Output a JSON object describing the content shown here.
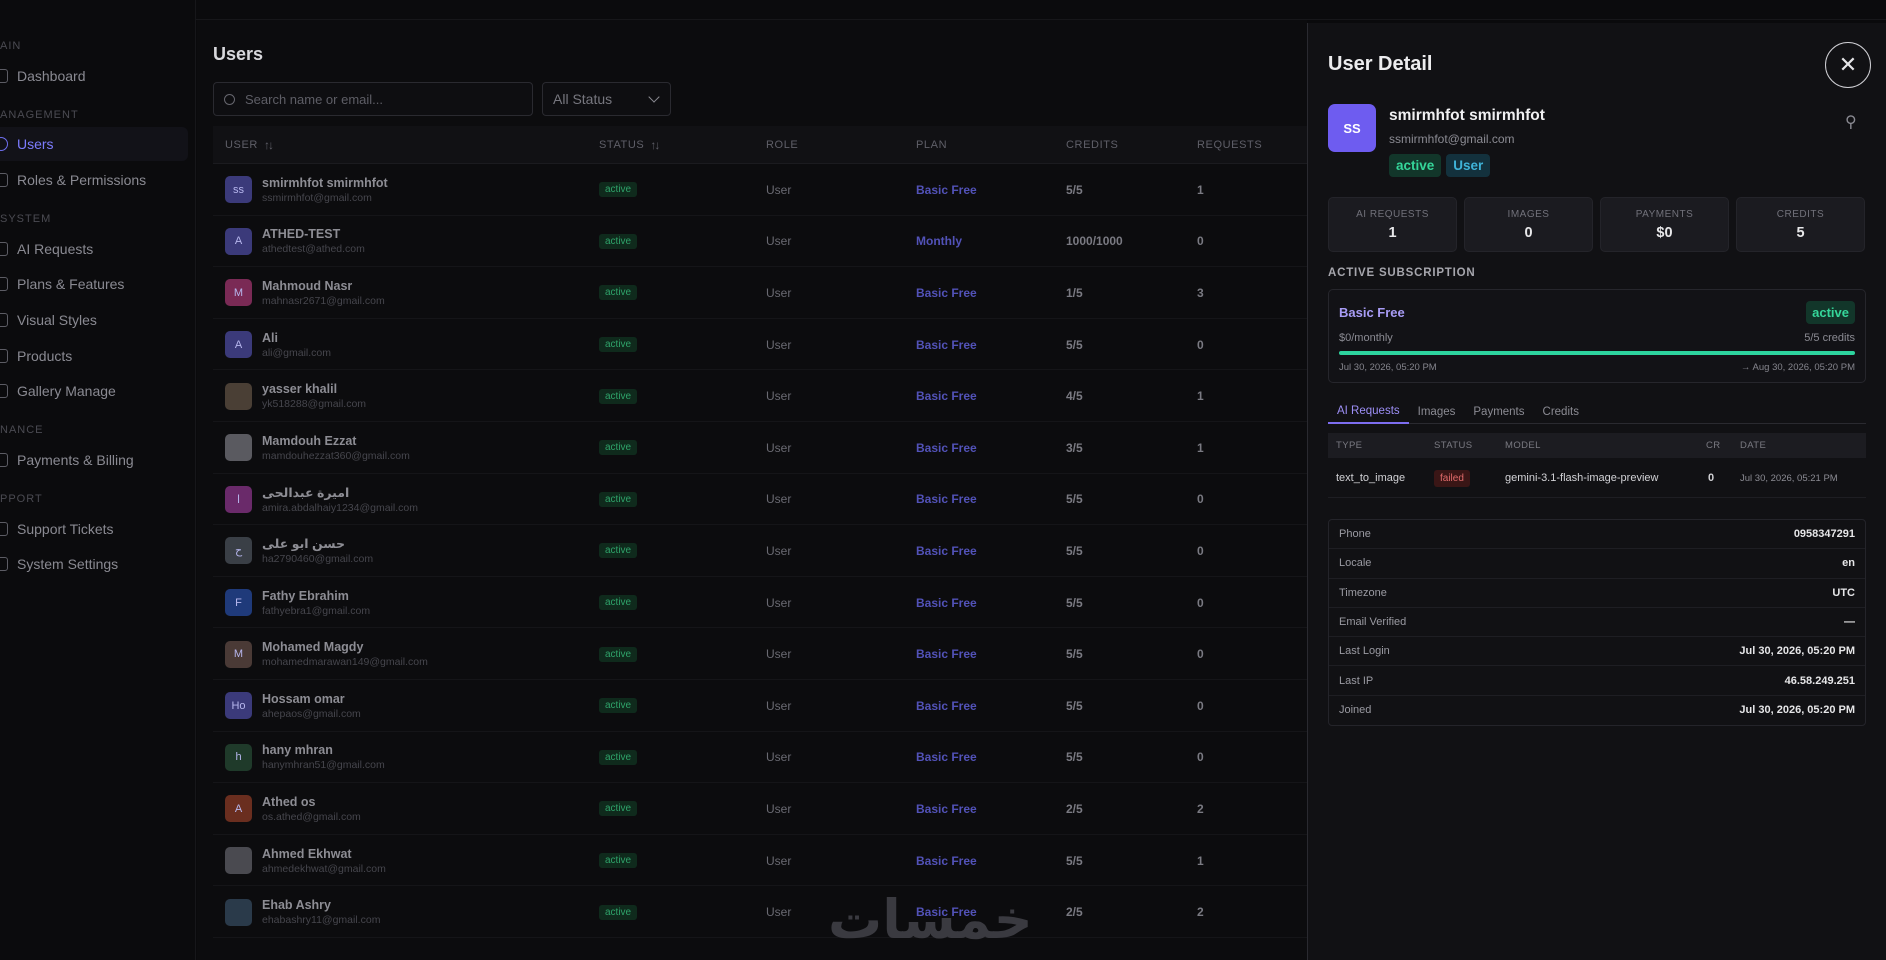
{
  "sidebar": {
    "sections": [
      "AIN",
      "ANAGEMENT",
      "SYSTEM",
      "NANCE",
      "PPORT"
    ],
    "items": [
      {
        "label": "Dashboard"
      },
      {
        "label": "Users"
      },
      {
        "label": "Roles & Permissions"
      },
      {
        "label": "AI Requests"
      },
      {
        "label": "Plans & Features"
      },
      {
        "label": "Visual Styles"
      },
      {
        "label": "Products"
      },
      {
        "label": "Gallery Manage"
      },
      {
        "label": "Payments & Billing"
      },
      {
        "label": "Support Tickets"
      },
      {
        "label": "System Settings"
      }
    ]
  },
  "main": {
    "title": "Users",
    "search_placeholder": "Search name or email...",
    "status_filter": "All Status",
    "columns": [
      "USER",
      "STATUS",
      "ROLE",
      "PLAN",
      "CREDITS",
      "REQUESTS"
    ],
    "rows": [
      {
        "initials": "ss",
        "avatar_color": "#3b3a7a",
        "name": "smirmhfot smirmhfot",
        "email": "ssmirmhfot@gmail.com",
        "status": "active",
        "role": "User",
        "plan": "Basic Free",
        "credits": "5/5",
        "requests": "1"
      },
      {
        "initials": "A",
        "avatar_color": "#3b3a7a",
        "name": "ATHED-TEST",
        "email": "athedtest@athed.com",
        "status": "active",
        "role": "User",
        "plan": "Monthly",
        "credits": "1000/1000",
        "requests": "0"
      },
      {
        "initials": "M",
        "avatar_color": "#7a2a55",
        "name": "Mahmoud Nasr",
        "email": "mahnasr2671@gmail.com",
        "status": "active",
        "role": "User",
        "plan": "Basic Free",
        "credits": "1/5",
        "requests": "3"
      },
      {
        "initials": "A",
        "avatar_color": "#3b3a7a",
        "name": "Ali",
        "email": "ali@gmail.com",
        "status": "active",
        "role": "User",
        "plan": "Basic Free",
        "credits": "5/5",
        "requests": "0"
      },
      {
        "initials": "",
        "avatar_color": "#4a3f35",
        "name": "yasser khalil",
        "email": "yk518288@gmail.com",
        "status": "active",
        "role": "User",
        "plan": "Basic Free",
        "credits": "4/5",
        "requests": "1"
      },
      {
        "initials": "",
        "avatar_color": "#5a5a60",
        "name": "Mamdouh Ezzat",
        "email": "mamdouhezzat360@gmail.com",
        "status": "active",
        "role": "User",
        "plan": "Basic Free",
        "credits": "3/5",
        "requests": "1"
      },
      {
        "initials": "ا",
        "avatar_color": "#6a2a6a",
        "name": "اميرة عبدالحى",
        "email": "amira.abdalhaiy1234@gmail.com",
        "status": "active",
        "role": "User",
        "plan": "Basic Free",
        "credits": "5/5",
        "requests": "0"
      },
      {
        "initials": "ح",
        "avatar_color": "#3a3f46",
        "name": "حسن ابو على",
        "email": "ha2790460@gmail.com",
        "status": "active",
        "role": "User",
        "plan": "Basic Free",
        "credits": "5/5",
        "requests": "0"
      },
      {
        "initials": "F",
        "avatar_color": "#1f3a7a",
        "name": "Fathy Ebrahim",
        "email": "fathyebra1@gmail.com",
        "status": "active",
        "role": "User",
        "plan": "Basic Free",
        "credits": "5/5",
        "requests": "0"
      },
      {
        "initials": "M",
        "avatar_color": "#4a3a36",
        "name": "Mohamed Magdy",
        "email": "mohamedmarawan149@gmail.com",
        "status": "active",
        "role": "User",
        "plan": "Basic Free",
        "credits": "5/5",
        "requests": "0"
      },
      {
        "initials": "Ho",
        "avatar_color": "#3b3a7a",
        "name": "Hossam omar",
        "email": "ahepaos@gmail.com",
        "status": "active",
        "role": "User",
        "plan": "Basic Free",
        "credits": "5/5",
        "requests": "0"
      },
      {
        "initials": "h",
        "avatar_color": "#1f3a2a",
        "name": "hany mhran",
        "email": "hanymhran51@gmail.com",
        "status": "active",
        "role": "User",
        "plan": "Basic Free",
        "credits": "5/5",
        "requests": "0"
      },
      {
        "initials": "A",
        "avatar_color": "#6a2e1f",
        "name": "Athed os",
        "email": "os.athed@gmail.com",
        "status": "active",
        "role": "User",
        "plan": "Basic Free",
        "credits": "2/5",
        "requests": "2"
      },
      {
        "initials": "",
        "avatar_color": "#4a4a50",
        "name": "Ahmed Ekhwat",
        "email": "ahmedekhwat@gmail.com",
        "status": "active",
        "role": "User",
        "plan": "Basic Free",
        "credits": "5/5",
        "requests": "1"
      },
      {
        "initials": "",
        "avatar_color": "#2a3a4a",
        "name": "Ehab Ashry",
        "email": "ehabashry11@gmail.com",
        "status": "active",
        "role": "User",
        "plan": "Basic Free",
        "credits": "2/5",
        "requests": "2"
      }
    ]
  },
  "watermark": "خمسات",
  "drawer": {
    "title": "User Detail",
    "close_glyph": "✕",
    "key_glyph": "⚲",
    "user": {
      "initials": "SS",
      "name": "smirmhfot smirmhfot",
      "email": "ssmirmhfot@gmail.com",
      "status": "active",
      "role": "User"
    },
    "stats": [
      {
        "label": "AI REQUESTS",
        "value": "1"
      },
      {
        "label": "IMAGES",
        "value": "0"
      },
      {
        "label": "PAYMENTS",
        "value": "$0"
      },
      {
        "label": "CREDITS",
        "value": "5"
      }
    ],
    "subscription": {
      "section_title": "ACTIVE SUBSCRIPTION",
      "plan": "Basic Free",
      "status": "active",
      "price": "$0/monthly",
      "credits": "5/5 credits",
      "credits_fraction": 1.0,
      "start": "Jul 30, 2026, 05:20 PM",
      "end": "→ Aug 30, 2026, 05:20 PM"
    },
    "tabs": [
      "AI Requests",
      "Images",
      "Payments",
      "Credits"
    ],
    "requests": {
      "columns": [
        "TYPE",
        "STATUS",
        "MODEL",
        "CR",
        "DATE"
      ],
      "rows": [
        {
          "type": "text_to_image",
          "status": "failed",
          "model": "gemini-3.1-flash-image-preview",
          "cr": "0",
          "date": "Jul 30, 2026, 05:21 PM"
        }
      ]
    },
    "info": [
      {
        "key": "Phone",
        "value": "0958347291"
      },
      {
        "key": "Locale",
        "value": "en"
      },
      {
        "key": "Timezone",
        "value": "UTC"
      },
      {
        "key": "Email Verified",
        "value": "—"
      },
      {
        "key": "Last Login",
        "value": "Jul 30, 2026, 05:20 PM"
      },
      {
        "key": "Last IP",
        "value": "46.58.249.251"
      },
      {
        "key": "Joined",
        "value": "Jul 30, 2026, 05:20 PM"
      }
    ]
  }
}
